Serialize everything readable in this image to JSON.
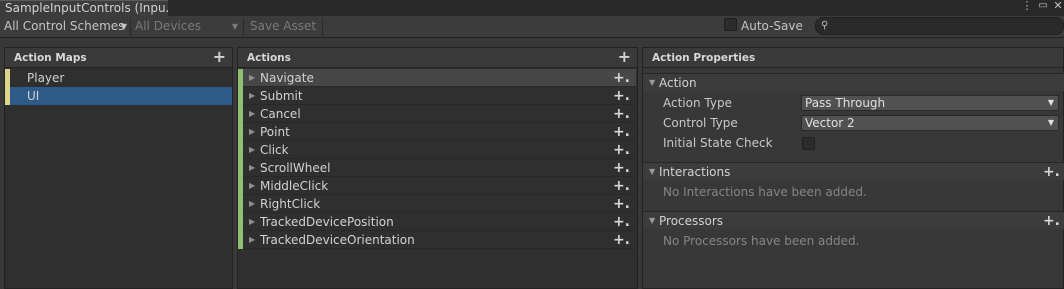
{
  "window": {
    "tab_title": "SampleInputControls (Inpu...",
    "menu_icon": "kebab-menu-icon",
    "maximize_icon": "maximize-icon",
    "close_icon": "close-icon"
  },
  "toolbar": {
    "control_schemes": "All Control Schemes",
    "devices": "All Devices",
    "save_asset": "Save Asset",
    "auto_save_label": "Auto-Save",
    "auto_save_checked": false,
    "search_placeholder": ""
  },
  "action_maps": {
    "header": "Action Maps",
    "items": [
      {
        "label": "Player",
        "selected": false
      },
      {
        "label": "UI",
        "selected": true
      }
    ]
  },
  "actions": {
    "header": "Actions",
    "items": [
      {
        "label": "Navigate"
      },
      {
        "label": "Submit"
      },
      {
        "label": "Cancel"
      },
      {
        "label": "Point"
      },
      {
        "label": "Click"
      },
      {
        "label": "ScrollWheel"
      },
      {
        "label": "MiddleClick"
      },
      {
        "label": "RightClick"
      },
      {
        "label": "TrackedDevicePosition"
      },
      {
        "label": "TrackedDeviceOrientation"
      }
    ]
  },
  "properties": {
    "header": "Action Properties",
    "action_section": "Action",
    "action_type_label": "Action Type",
    "action_type_value": "Pass Through",
    "control_type_label": "Control Type",
    "control_type_value": "Vector 2",
    "initial_state_label": "Initial State Check",
    "initial_state_checked": false,
    "interactions_section": "Interactions",
    "interactions_empty": "No Interactions have been added.",
    "processors_section": "Processors",
    "processors_empty": "No Processors have been added."
  },
  "colors": {
    "map_marker": "#ddd68a",
    "action_marker": "#8fbf73",
    "selection": "#2d5a87"
  }
}
